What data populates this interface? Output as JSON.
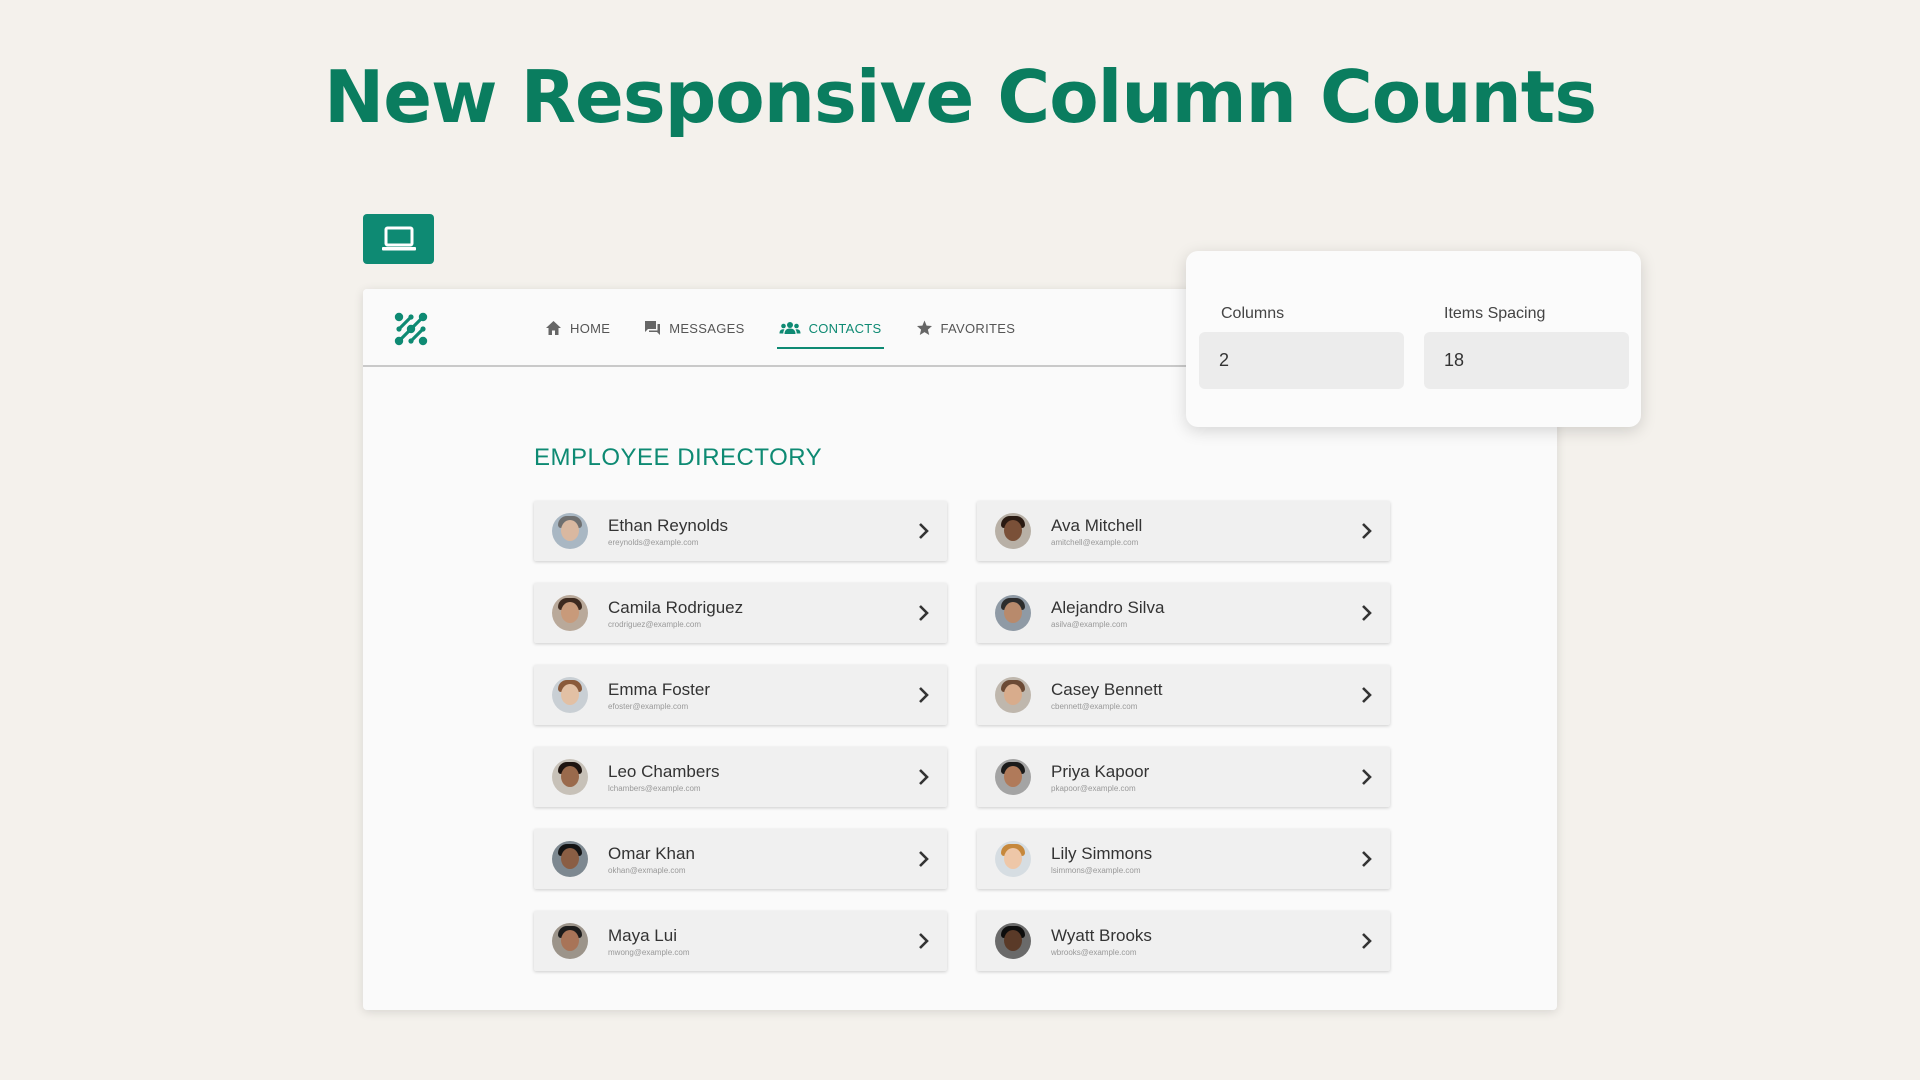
{
  "headline": "New Responsive Column Counts",
  "device_icon": "laptop-icon",
  "nav": [
    {
      "label": "HOME",
      "icon": "home-icon"
    },
    {
      "label": "MESSAGES",
      "icon": "chat-icon"
    },
    {
      "label": "CONTACTS",
      "icon": "people-icon",
      "active": true
    },
    {
      "label": "FAVORITES",
      "icon": "star-icon"
    }
  ],
  "directory_title": "EMPLOYEE DIRECTORY",
  "contacts": [
    {
      "name": "Ethan Reynolds",
      "email": "ereynolds@example.com"
    },
    {
      "name": "Ava Mitchell",
      "email": "amitchell@example.com"
    },
    {
      "name": "Camila Rodriguez",
      "email": "crodriguez@example.com"
    },
    {
      "name": "Alejandro Silva",
      "email": "asilva@example.com"
    },
    {
      "name": "Emma Foster",
      "email": "efoster@example.com"
    },
    {
      "name": "Casey Bennett",
      "email": "cbennett@example.com"
    },
    {
      "name": "Leo Chambers",
      "email": "lchambers@example.com"
    },
    {
      "name": "Priya Kapoor",
      "email": "pkapoor@example.com"
    },
    {
      "name": "Omar Khan",
      "email": "okhan@exmaple.com"
    },
    {
      "name": "Lily Simmons",
      "email": "lsimmons@example.com"
    },
    {
      "name": "Maya Lui",
      "email": "mwong@example.com"
    },
    {
      "name": "Wyatt Brooks",
      "email": "wbrooks@example.com"
    }
  ],
  "settings": {
    "columns_label": "Columns",
    "columns_value": "2",
    "spacing_label": "Items Spacing",
    "spacing_value": "18"
  },
  "colors": {
    "accent": "#0e8a73",
    "headline": "#0a7d5f",
    "background": "#f4f1ec"
  }
}
